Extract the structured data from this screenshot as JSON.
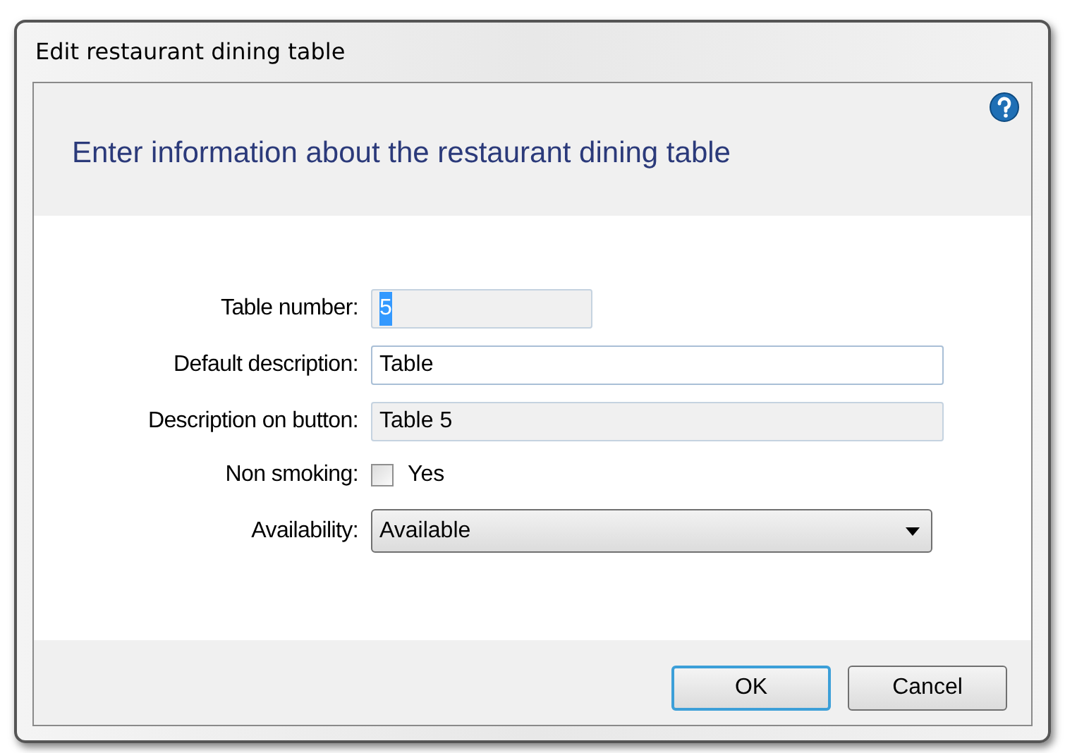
{
  "window": {
    "title": "Edit restaurant dining table"
  },
  "header": {
    "title": "Enter information about the restaurant dining table"
  },
  "fields": [
    {
      "kind": "text",
      "label": "Table number:",
      "value": "5",
      "readonly": true,
      "value_selected": true
    },
    {
      "kind": "text",
      "label": "Default description:",
      "value": "Table",
      "readonly": false,
      "value_selected": false
    },
    {
      "kind": "text",
      "label": "Description on button:",
      "value": "Table 5",
      "readonly": true,
      "value_selected": false
    },
    {
      "kind": "checkbox",
      "label": "Non smoking:",
      "option": "Yes",
      "checked": false
    },
    {
      "kind": "dropdown",
      "label": "Availability:",
      "value": "Available"
    }
  ],
  "buttons": [
    {
      "label": "OK",
      "default": true
    },
    {
      "label": "Cancel",
      "default": false
    }
  ]
}
